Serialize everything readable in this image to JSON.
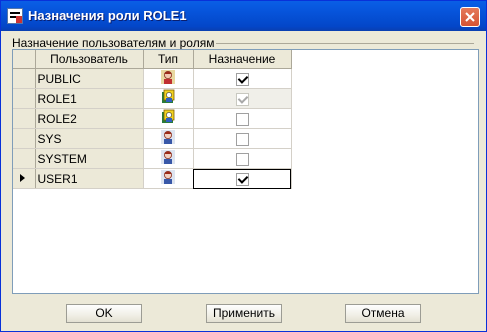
{
  "window": {
    "title": "Назначения роли ROLE1"
  },
  "group": {
    "label": "Назначение пользователям и ролям"
  },
  "grid": {
    "headers": {
      "user": "Пользователь",
      "type": "Тип",
      "assign": "Назначение"
    },
    "rows": [
      {
        "name": "PUBLIC",
        "type_icon": "user-role-icon",
        "assigned": true,
        "disabled": false,
        "gray": false,
        "current": false
      },
      {
        "name": "ROLE1",
        "type_icon": "role-icon",
        "assigned": true,
        "disabled": true,
        "gray": true,
        "current": false
      },
      {
        "name": "ROLE2",
        "type_icon": "role-icon",
        "assigned": false,
        "disabled": false,
        "gray": false,
        "current": false
      },
      {
        "name": "SYS",
        "type_icon": "user-icon",
        "assigned": false,
        "disabled": false,
        "gray": false,
        "current": false
      },
      {
        "name": "SYSTEM",
        "type_icon": "user-icon",
        "assigned": false,
        "disabled": false,
        "gray": false,
        "current": false
      },
      {
        "name": "USER1",
        "type_icon": "user-icon",
        "assigned": true,
        "disabled": false,
        "gray": false,
        "current": true
      }
    ]
  },
  "buttons": {
    "ok": "OK",
    "apply": "Применить",
    "cancel": "Отмена"
  }
}
